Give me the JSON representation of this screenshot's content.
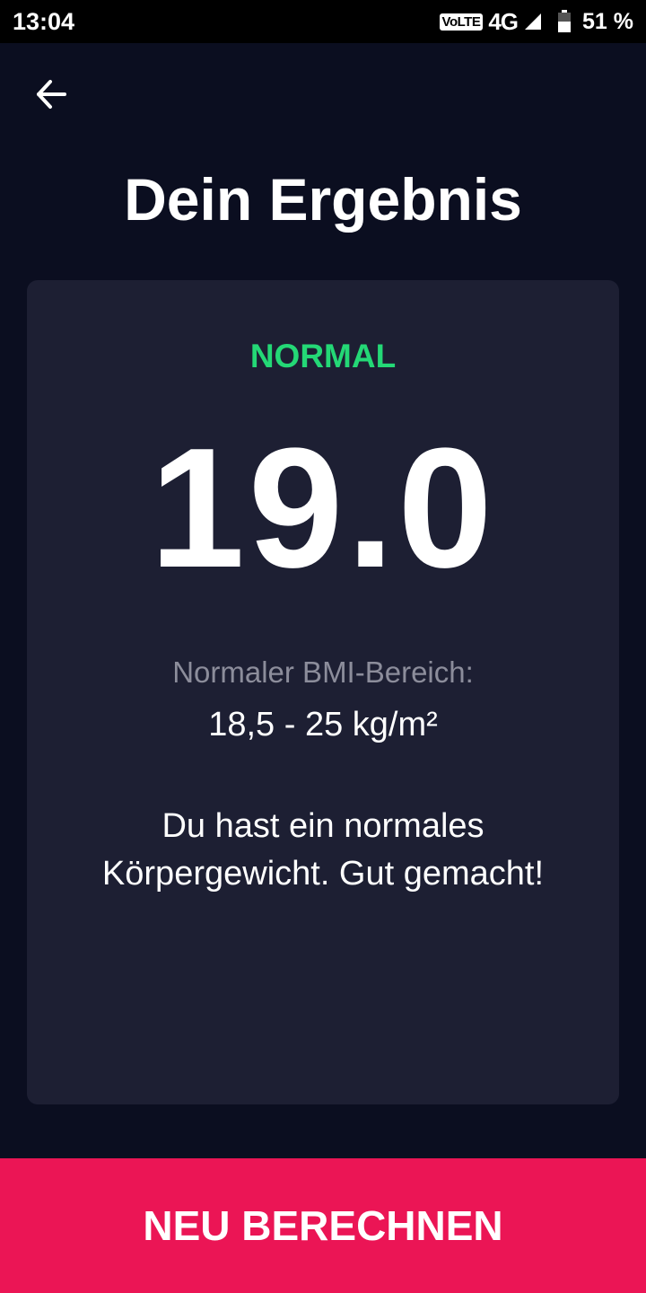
{
  "status_bar": {
    "time": "13:04",
    "volte": "VoLTE",
    "network": "4G",
    "battery": "51 %"
  },
  "header": {
    "back_icon": "arrow-left-icon",
    "title": "Dein Ergebnis"
  },
  "result": {
    "category": "NORMAL",
    "bmi": "19.0",
    "range_label": "Normaler BMI-Bereich:",
    "range_value": "18,5 - 25 kg/m²",
    "message": "Du hast ein normales Körpergewicht. Gut gemacht!"
  },
  "action": {
    "label": "NEU BERECHNEN"
  },
  "colors": {
    "background": "#0b0e20",
    "card": "#1d1f33",
    "category_green": "#24d876",
    "accent_pink": "#eb1555",
    "muted_text": "#8c8d9b"
  }
}
